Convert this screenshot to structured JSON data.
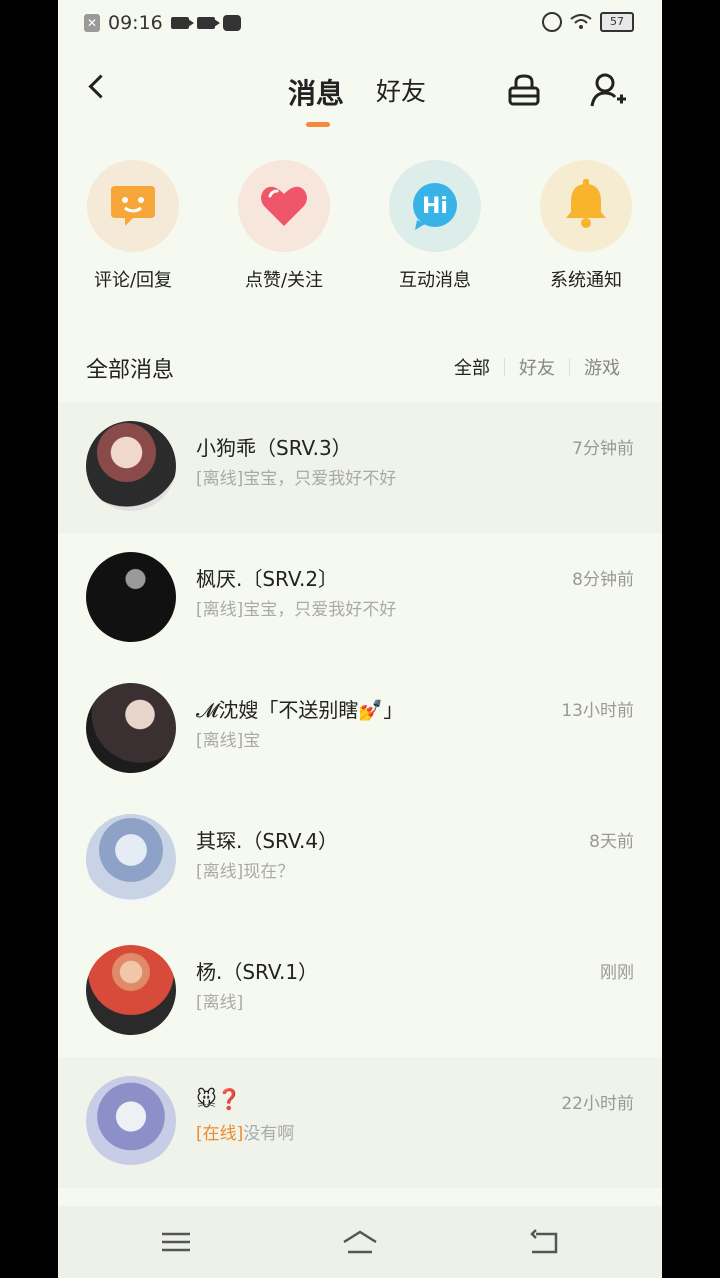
{
  "status_bar": {
    "time": "09:16",
    "battery": "57"
  },
  "header": {
    "tab_messages": "消息",
    "tab_friends": "好友"
  },
  "categories": [
    {
      "label": "评论/回复",
      "icon": "comment-icon",
      "color": "#f7a63a"
    },
    {
      "label": "点赞/关注",
      "icon": "heart-icon",
      "color": "#f0566a"
    },
    {
      "label": "互动消息",
      "icon": "hi-icon",
      "color": "#37b3e8"
    },
    {
      "label": "系统通知",
      "icon": "bell-icon",
      "color": "#f7b42c"
    }
  ],
  "section": {
    "title": "全部消息",
    "filters": [
      "全部",
      "好友",
      "游戏"
    ]
  },
  "messages": [
    {
      "name": "小狗乖（SRV.3）",
      "status": "[离线]",
      "text": "宝宝，只爱我好不好",
      "time": "7分钟前"
    },
    {
      "name": "枫厌.〔SRV.2〕",
      "status": "[离线]",
      "text": "宝宝，只爱我好不好",
      "time": "8分钟前"
    },
    {
      "name": "𝓜沈嫂「不送别瞎💅」",
      "status": "[离线]",
      "text": "宝",
      "time": "13小时前"
    },
    {
      "name": "其琛.（SRV.4）",
      "status": "[离线]",
      "text": "现在？",
      "time": "8天前"
    },
    {
      "name": "杨.（SRV.1）",
      "status": "[离线]",
      "text": "",
      "time": "刚刚"
    },
    {
      "name": "🐭❓",
      "status": "[在线]",
      "text": "没有啊",
      "time": "22小时前"
    }
  ],
  "colors": {
    "accent": "#f58a3c",
    "online": "#f08a2c",
    "background": "#f6f9ef"
  }
}
